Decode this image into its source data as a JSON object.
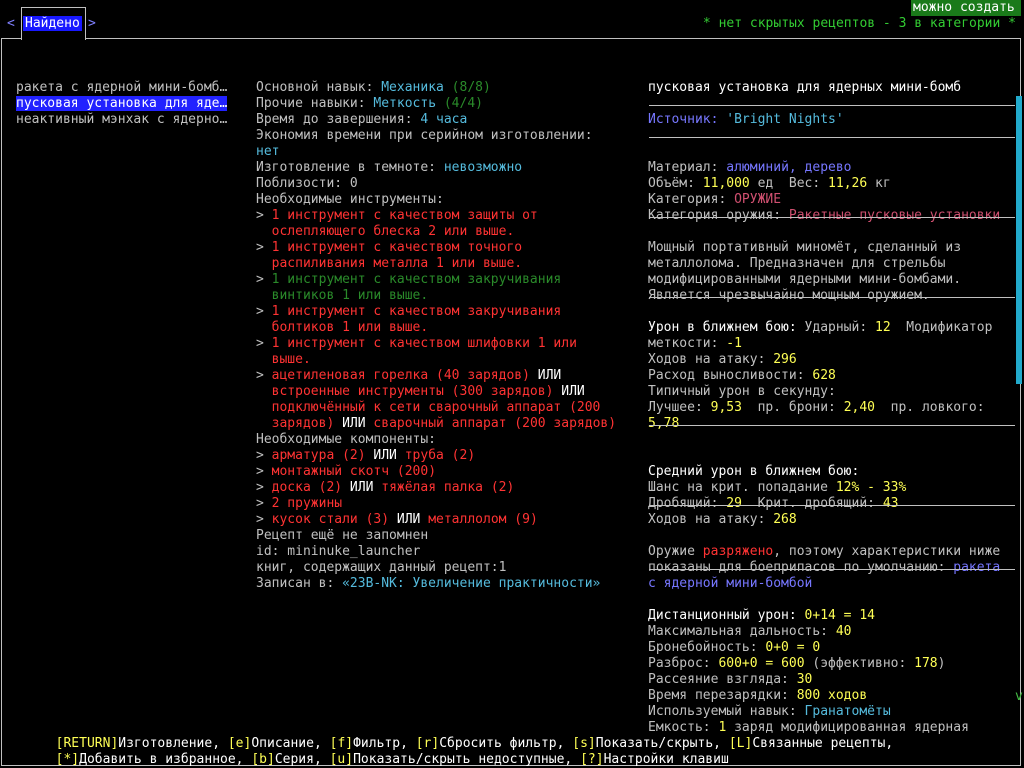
{
  "tab": {
    "left_arrow": "<",
    "label": "Найдено",
    "right_arrow": ">"
  },
  "header": {
    "create_badge": "можно создать",
    "hidden_info": "* нет скрытых рецептов - 3 в категории *"
  },
  "recipe_list": [
    {
      "name": "ракета с ядерной мини-бомб…",
      "selected": false
    },
    {
      "name": "пусковая установка для яде…",
      "selected": true
    },
    {
      "name": "неактивный мэнхак с ядерно…",
      "selected": false
    }
  ],
  "details": {
    "primary_skill_label": "Основной навык: ",
    "primary_skill": "Механика",
    "primary_skill_level": " (8/8)",
    "other_skills_label": "Прочие навыки: ",
    "other_skill": "Меткость",
    "other_skill_level": " (4/4)",
    "time_label": "Время до завершения: ",
    "time_value": "4 часа",
    "batch_label": "Экономия времени при серийном изготовлении:",
    "batch_value": "нет",
    "dark_label": "Изготовление в темноте: ",
    "dark_value": "невозможно",
    "nearby": "Поблизости: 0",
    "tools_header": "Необходимые инструменты:",
    "tool1_a": "1 инструмент с качеством защиты от",
    "tool1_b": "ослепляющего блеска 2 или выше.",
    "tool2_a": "1 инструмент с качеством точного",
    "tool2_b": "распиливания металла 1 или выше.",
    "tool3_a": "1 инструмент с качеством закручивания",
    "tool3_b": "винтиков 1 или выше.",
    "tool4_a": "1 инструмент с качеством закручивания",
    "tool4_b": "болтиков 1 или выше.",
    "tool5_a": "1 инструмент с качеством шлифовки 1 или",
    "tool5_b": "выше.",
    "weld1": "ацетиленовая горелка (40 зарядов)",
    "or1": " ИЛИ",
    "weld2": "встроенные инструменты (300 зарядов)",
    "or2": " ИЛИ",
    "weld3a": "подключённый к сети сварочный аппарат (200",
    "weld3b": "зарядов)",
    "or3": " ИЛИ ",
    "weld4": "сварочный аппарат (200 зарядов)",
    "components_header": "Необходимые компоненты:",
    "comp1": "арматура (2)",
    "comp1_or": " ИЛИ ",
    "comp1b": "труба (2)",
    "comp2": "монтажный скотч (200)",
    "comp3": "доска (2)",
    "comp3_or": " ИЛИ ",
    "comp3b": "тяжёлая палка (2)",
    "comp4": "2 пружины",
    "comp5": "кусок стали (3)",
    "comp5_or": " ИЛИ ",
    "comp5b": "металлолом (9)",
    "not_memorized": "Рецепт ещё не запомнен",
    "id_line": "id: mininuke_launcher",
    "books_line": "книг, содержащих данный рецепт:1",
    "written_label": "Записан в: ",
    "written_value": "«23B-NK: Увеличение практичности»"
  },
  "item": {
    "name": "пусковая установка для ядерных мини-бомб",
    "source_label": "Источник: ",
    "source_value": "'Bright Nights'",
    "material_label": "Материал: ",
    "material_value": "алюминий, дерево",
    "volume_label": "Объём: ",
    "volume_value": "11,000",
    "volume_unit": " ед  Вес: ",
    "weight_value": "11,26",
    "weight_unit": " кг",
    "category_label": "Категория: ",
    "category_value": "ОРУЖИЕ",
    "weapon_cat_label": "Категория оружия: ",
    "weapon_cat_value": "Ракетные пусковые установки",
    "desc1": "Мощный портативный миномёт, сделанный из",
    "desc2": "металлолома. Предназначен для стрельбы",
    "desc3": "модифицированными ядерными мини-бомбами.",
    "desc4": "Является чрезвычайно мощным оружием.",
    "melee_label": "Урон в ближнем бою:",
    "bash_label": " Ударный: ",
    "bash_value": "12",
    "mod_label": "  Модификатор",
    "acc_label": "меткости: ",
    "acc_value": "-1",
    "moves_label": "Ходов на атаку: ",
    "moves_value": "296",
    "stamina_label": "Расход выносливости: ",
    "stamina_value": "628",
    "dps_label": "Типичный урон в секунду:",
    "best_label": "Лучшее: ",
    "best_value": "9,53",
    "armor_label": "  пр. брони: ",
    "armor_value": "2,40",
    "agile_label": "  пр. ловкого:",
    "agile_value": "5,78",
    "avg_label": "Средний урон в ближнем бою:",
    "crit_label": "Шанс на крит. попадание ",
    "crit_value": "12% - 33%",
    "crush_label": "Дробящий: ",
    "crush_value": "29",
    "crit_crush_label": "  Крит. дробящий: ",
    "crit_crush_value": "43",
    "moves2_label": "Ходов на атаку: ",
    "moves2_value": "268",
    "unloaded1_a": "Оружие ",
    "unloaded1_b": "разряжено",
    "unloaded1_c": ", поэтому характеристики ниже",
    "unloaded2_a": "показаны для боеприпасов по умолчанию: ",
    "unloaded2_b": "ракета",
    "unloaded3": "с ядерной мини-бомбой",
    "ranged_label": "Дистанционный урон: ",
    "ranged_value": "0+14 = 14",
    "range_label": "Максимальная дальность: ",
    "range_value": "40",
    "pierce_label": "Бронебойность: ",
    "pierce_value": "0+0 = 0",
    "disp_label": "Разброс: ",
    "disp_value": "600+0 = 600",
    "disp_eff": " (эффективно: ",
    "disp_eff_value": "178",
    "disp_end": ")",
    "sight_label": "Рассеяние взгляда: ",
    "sight_value": "30",
    "reload_label": "Время перезарядки: ",
    "reload_value": "800 ходов",
    "skill_label": "Используемый навык: ",
    "skill_value": "Гранатомёты",
    "cap_label": "Ёмкость: ",
    "cap_value": "1",
    "cap_rest": " заряд модифицированная ядерная",
    "more_indicator": "v"
  },
  "footer": {
    "line1": [
      {
        "key": "[RETURN]",
        "text": "Изготовление, "
      },
      {
        "key": "[e]",
        "text": "Описание, "
      },
      {
        "key": "[f]",
        "text": "Фильтр, "
      },
      {
        "key": "[r]",
        "text": "Сбросить фильтр, "
      },
      {
        "key": "[s]",
        "text": "Показать/скрыть, "
      },
      {
        "key": "[L]",
        "text": "Связанные рецепты,"
      }
    ],
    "line2": [
      {
        "key": "[*]",
        "text": "Добавить в избранное, "
      },
      {
        "key": "[b]",
        "text": "Серия, "
      },
      {
        "key": "[u]",
        "text": "Показать/скрыть недоступные, "
      },
      {
        "key": "[?]",
        "text": "Настройки клавиш"
      }
    ]
  }
}
